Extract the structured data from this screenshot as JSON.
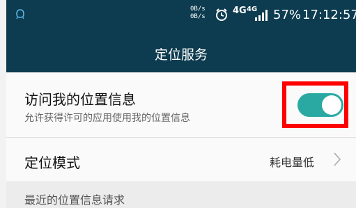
{
  "status_bar": {
    "upload_rate": "0B/s",
    "download_rate": "0B/s",
    "network_1": "4G",
    "network_2": "4G",
    "battery": "57%",
    "time": "17:12:57",
    "icons": [
      "notification-icon",
      "alarm-icon",
      "signal-icon"
    ]
  },
  "header": {
    "title": "定位服务"
  },
  "location_access": {
    "title": "访问我的位置信息",
    "subtitle": "允许获得许可的应用使用我的位置信息",
    "enabled": true
  },
  "location_mode": {
    "title": "定位模式",
    "value": "耗电量低"
  },
  "recent_requests": {
    "title": "最近的位置信息请求"
  },
  "colors": {
    "header_bg": "#0d3b4f",
    "toggle_on": "#2aa9a3",
    "highlight": "#ff0000"
  }
}
